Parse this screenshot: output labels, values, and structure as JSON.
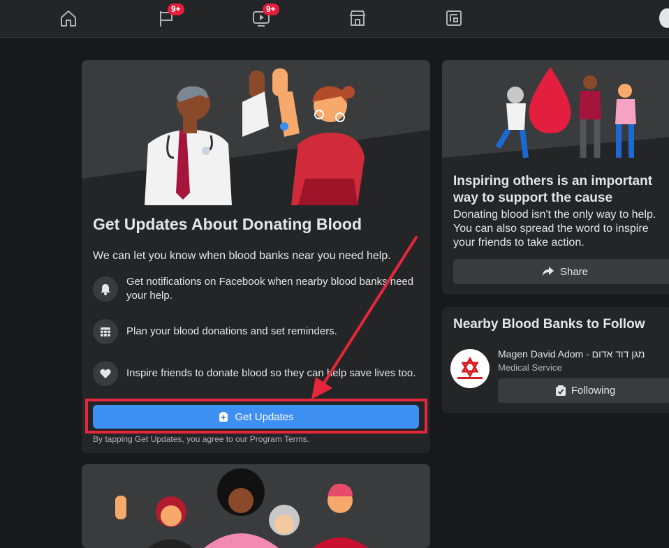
{
  "nav": {
    "home_icon": "home-icon",
    "pages_icon": "flag-icon",
    "pages_badge": "9+",
    "watch_icon": "video-icon",
    "watch_badge": "9+",
    "marketplace_icon": "store-icon",
    "gaming_icon": "gaming-icon"
  },
  "main": {
    "title": "Get Updates About Donating Blood",
    "subtitle": "We can let you know when blood banks near you need help.",
    "features": [
      {
        "icon": "bell-icon",
        "text": "Get notifications on Facebook when nearby blood banks need your help."
      },
      {
        "icon": "calendar-icon",
        "text": "Plan your blood donations and set reminders."
      },
      {
        "icon": "heart-icon",
        "text": "Inspire friends to donate blood so they can help save lives too."
      }
    ],
    "button_label": "Get Updates",
    "terms": "By tapping Get Updates, you agree to our Program Terms."
  },
  "promo": {
    "title": "Inspiring others is an important way to support the cause",
    "body": "Donating blood isn't the only way to help. You can also spread the word to inspire your friends to take action.",
    "share_label": "Share"
  },
  "banks": {
    "title": "Nearby Blood Banks to Follow",
    "bank_name": "Magen David Adom - מגן דוד אדום",
    "bank_type": "Medical Service",
    "following_label": "Following"
  },
  "colors": {
    "background": "#18191a",
    "card": "#242526",
    "accent_blue": "#3e8ff2",
    "highlight_red": "#e8263b"
  }
}
